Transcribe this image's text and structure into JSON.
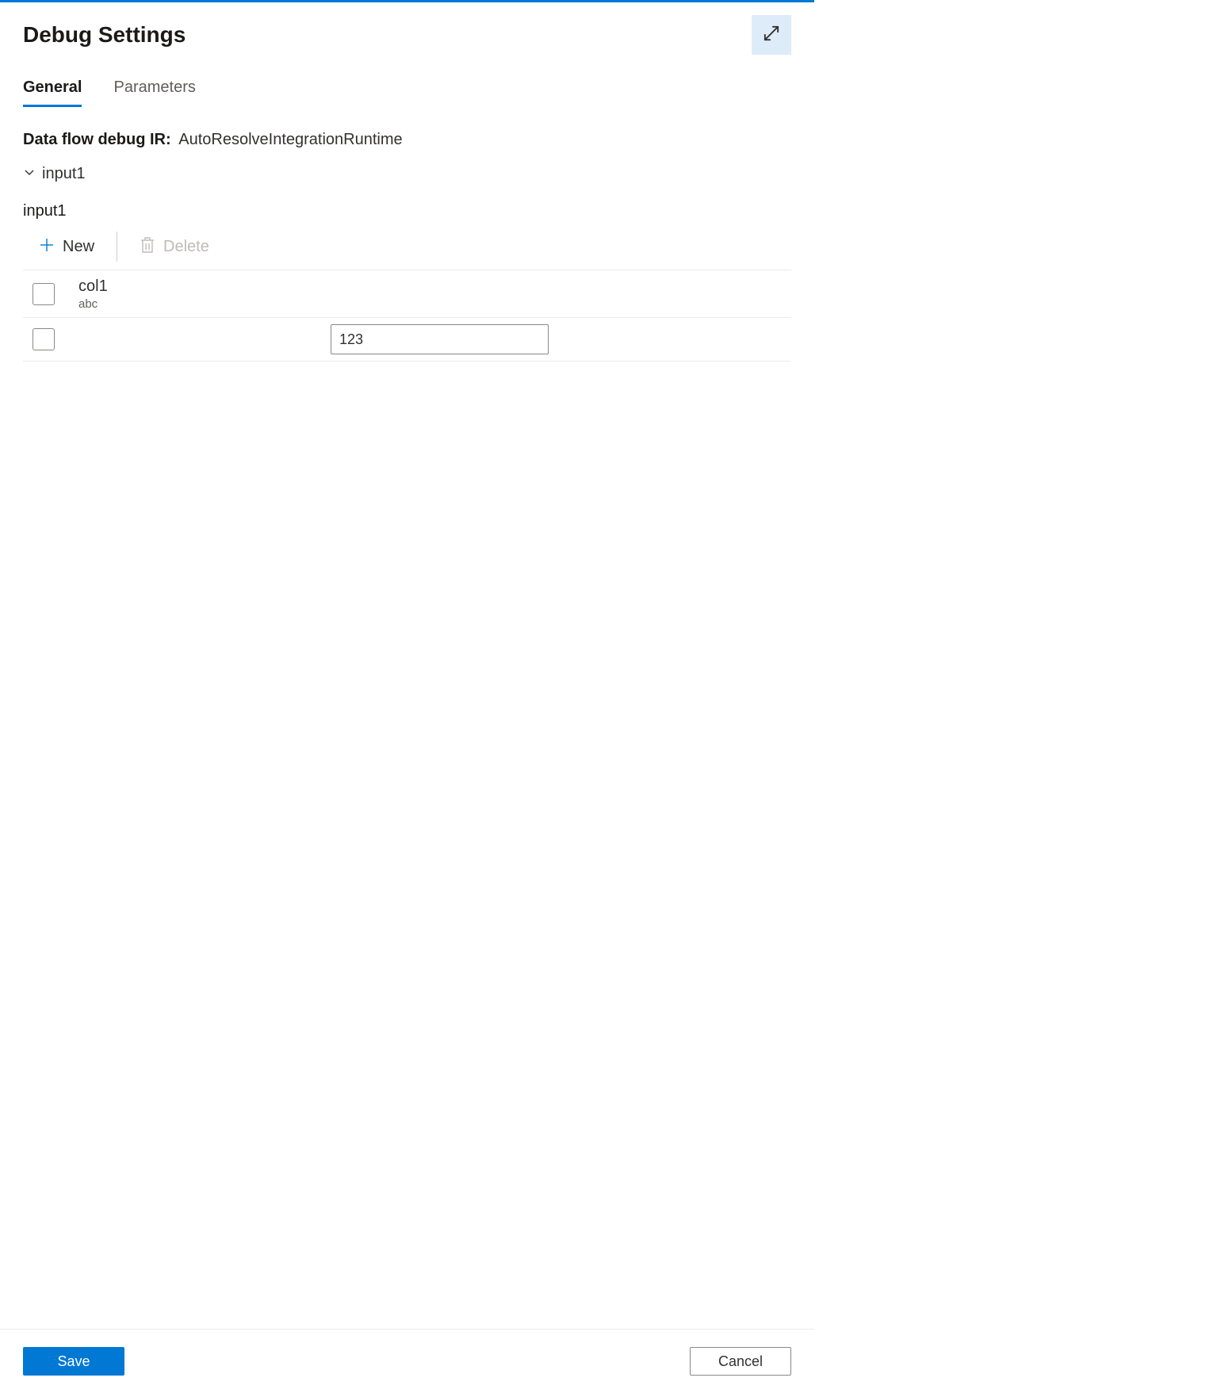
{
  "header": {
    "title": "Debug Settings"
  },
  "tabs": {
    "general": "General",
    "parameters": "Parameters"
  },
  "content": {
    "ir_label": "Data flow debug IR:",
    "ir_value": "AutoResolveIntegrationRuntime",
    "collapser_label": "input1",
    "section_label": "input1"
  },
  "toolbar": {
    "new_label": "New",
    "delete_label": "Delete"
  },
  "table": {
    "header": {
      "col_name": "col1",
      "col_type": "abc"
    },
    "rows": [
      {
        "value": "123"
      }
    ]
  },
  "footer": {
    "save": "Save",
    "cancel": "Cancel"
  }
}
